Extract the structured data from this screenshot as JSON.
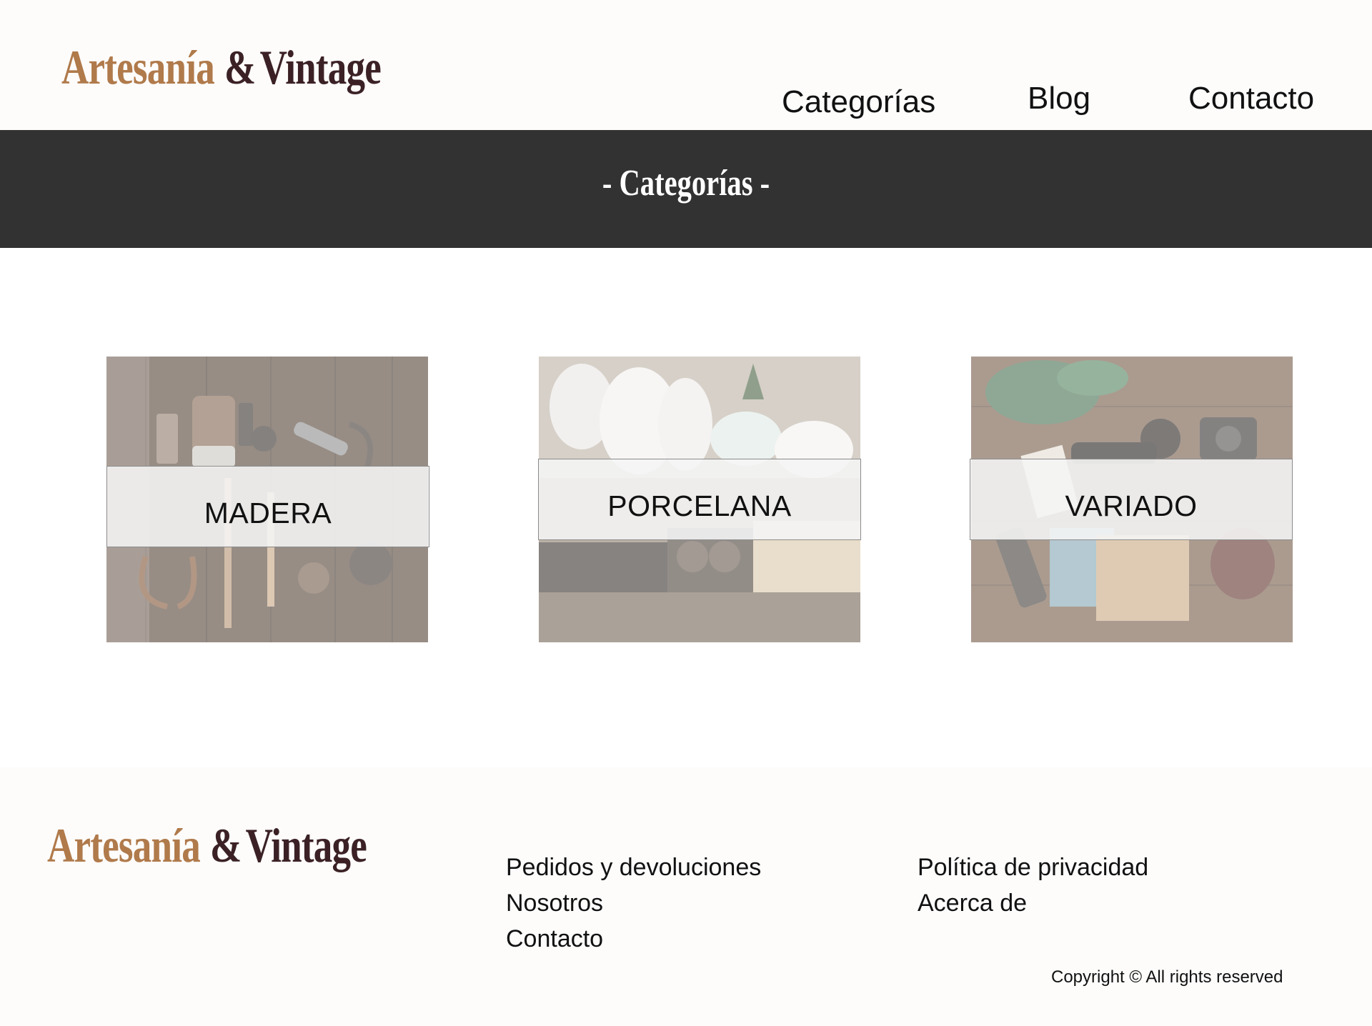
{
  "header": {
    "logo": {
      "word1": "Artesanía",
      "amp": "&",
      "word2": "Vintage"
    },
    "nav": [
      {
        "label": "Categorías"
      },
      {
        "label": "Blog"
      },
      {
        "label": "Contacto"
      }
    ]
  },
  "banner": {
    "title": "- Categorías -"
  },
  "categories": [
    {
      "label": "MADERA"
    },
    {
      "label": "PORCELANA"
    },
    {
      "label": "VARIADO"
    }
  ],
  "footer": {
    "logo": {
      "word1": "Artesanía",
      "amp": "&",
      "word2": "Vintage"
    },
    "links_col1": [
      {
        "label": "Pedidos y devoluciones"
      },
      {
        "label": "Nosotros"
      },
      {
        "label": "Contacto"
      }
    ],
    "links_col2": [
      {
        "label": "Política de privacidad"
      },
      {
        "label": "Acerca de"
      }
    ],
    "copyright": "Copyright © All rights reserved"
  },
  "colors": {
    "logo_primary": "#b07a4b",
    "logo_secondary": "#3b2125",
    "banner_bg": "#323232",
    "header_bg": "#fdfcfb"
  }
}
